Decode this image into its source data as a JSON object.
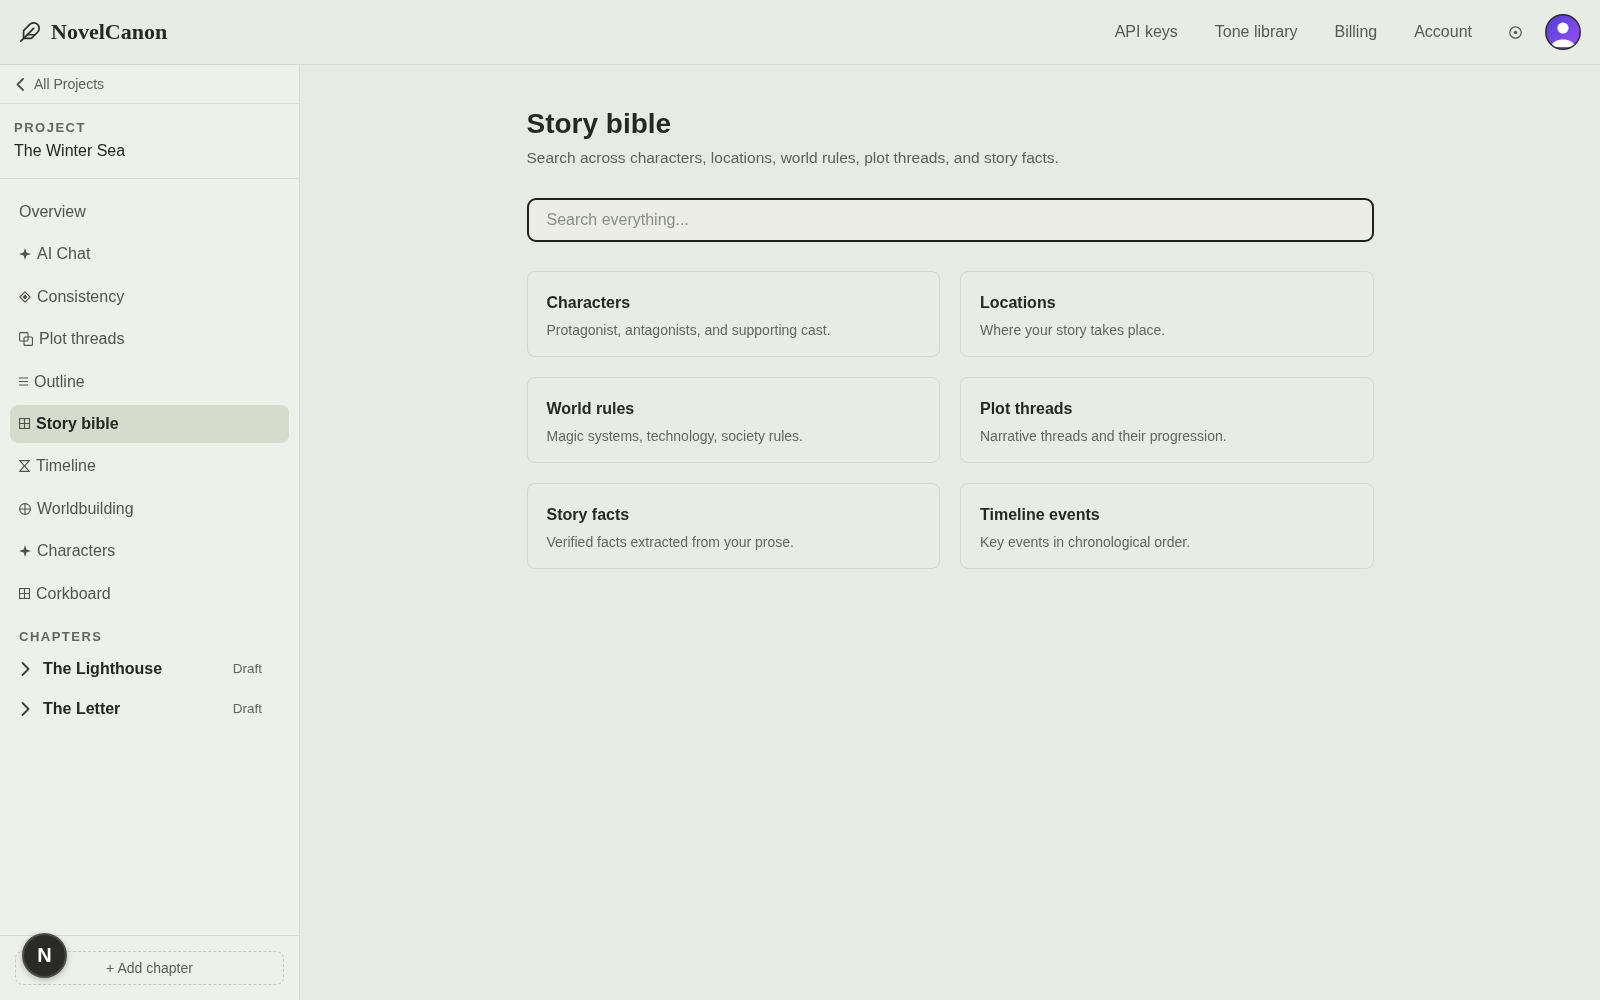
{
  "app": {
    "name": "NovelCanon"
  },
  "top_nav": {
    "links": [
      "API keys",
      "Tone library",
      "Billing",
      "Account"
    ]
  },
  "sidebar": {
    "back_link": "All Projects",
    "project": {
      "label": "PROJECT",
      "name": "The Winter Sea"
    },
    "nav_items": [
      {
        "label": "Overview",
        "selected": false
      },
      {
        "label": "AI Chat",
        "selected": false
      },
      {
        "label": "Consistency",
        "selected": false
      },
      {
        "label": "Plot threads",
        "selected": false
      },
      {
        "label": "Outline",
        "selected": false
      },
      {
        "label": "Story bible",
        "selected": true
      },
      {
        "label": "Timeline",
        "selected": false
      },
      {
        "label": "Worldbuilding",
        "selected": false
      },
      {
        "label": "Characters",
        "selected": false
      },
      {
        "label": "Corkboard",
        "selected": false
      }
    ],
    "chapters": {
      "heading": "CHAPTERS",
      "items": [
        {
          "title": "The Lighthouse",
          "status": "Draft",
          "expanded": false
        },
        {
          "title": "The Letter",
          "status": "Draft",
          "expanded": false
        }
      ]
    },
    "add_chapter": "+ Add chapter"
  },
  "dev_indicator": "N",
  "main": {
    "title": "Story bible",
    "subtitle": "Search across characters, locations, world rules, plot threads, and story facts.",
    "search": {
      "placeholder": "Search everything..."
    },
    "cards": [
      {
        "title": "Characters",
        "description": "Protagonist, antagonists, and supporting cast."
      },
      {
        "title": "Locations",
        "description": "Where your story takes place."
      },
      {
        "title": "World rules",
        "description": "Magic systems, technology, society rules."
      },
      {
        "title": "Plot threads",
        "description": "Narrative threads and their progression."
      },
      {
        "title": "Story facts",
        "description": "Verified facts extracted from your prose."
      },
      {
        "title": "Timeline events",
        "description": "Key events in chronological order."
      }
    ]
  }
}
